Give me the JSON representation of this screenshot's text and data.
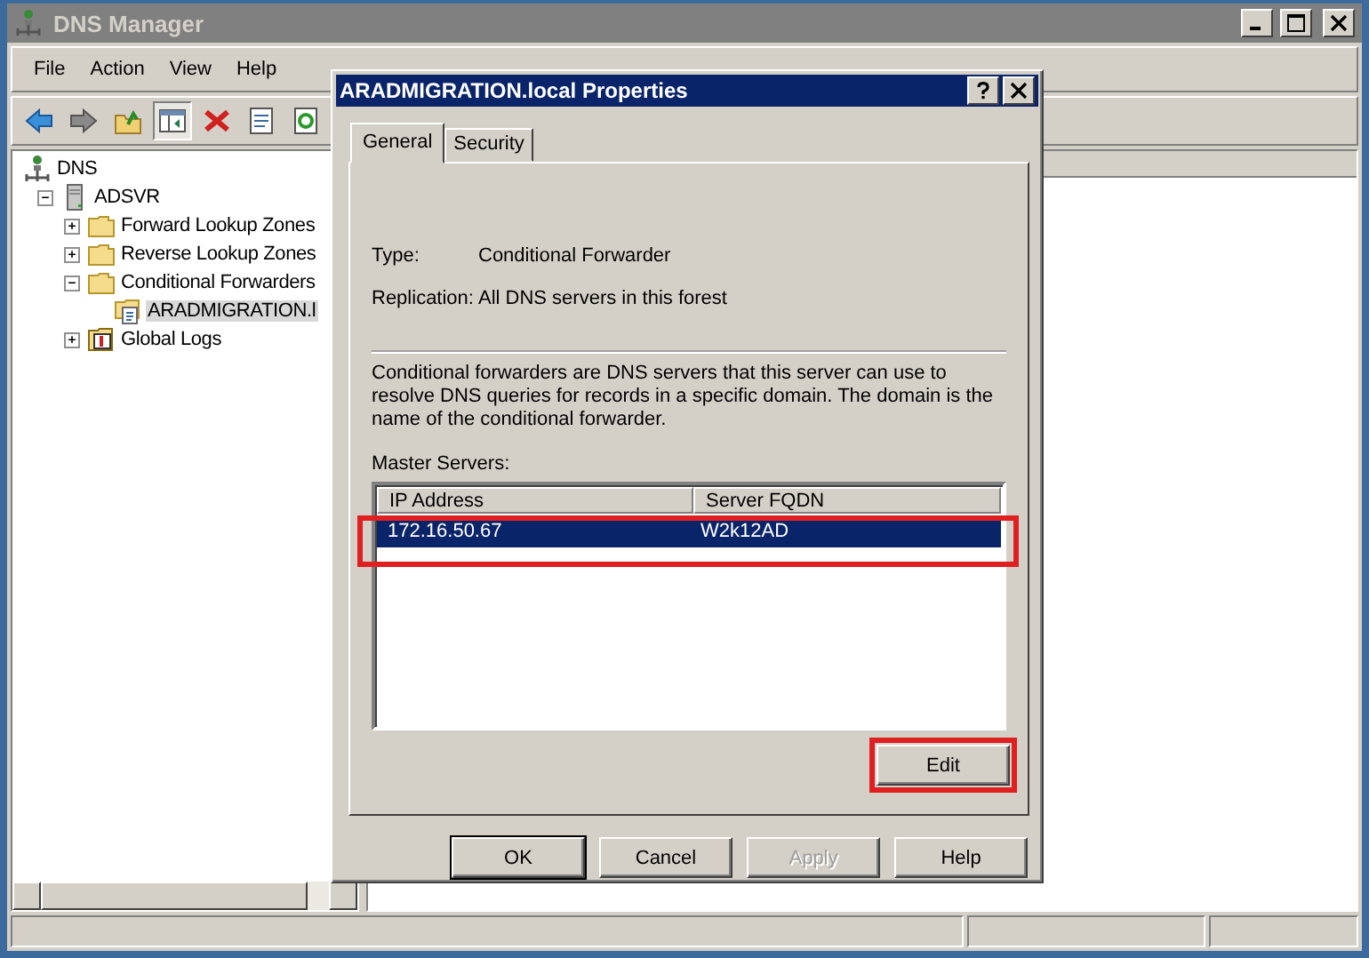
{
  "window": {
    "title": "DNS Manager"
  },
  "menu": [
    "File",
    "Action",
    "View",
    "Help"
  ],
  "toolbar": [
    {
      "kind": "back",
      "pressed": false
    },
    {
      "kind": "forward",
      "pressed": false
    },
    {
      "kind": "up",
      "pressed": false
    },
    {
      "kind": "tree",
      "pressed": true
    },
    {
      "kind": "delete",
      "pressed": false
    },
    {
      "kind": "properties",
      "pressed": false
    },
    {
      "kind": "refresh",
      "pressed": false
    }
  ],
  "tree": [
    {
      "label": "DNS",
      "kind": "dns",
      "selected": false,
      "children": [
        {
          "label": "ADSVR",
          "kind": "server",
          "expanded": true,
          "selected": false,
          "children": [
            {
              "label": "Forward Lookup Zones",
              "kind": "folder",
              "expanded": false,
              "selected": false
            },
            {
              "label": "Reverse Lookup Zones",
              "kind": "folder",
              "expanded": false,
              "selected": false
            },
            {
              "label": "Conditional Forwarders",
              "kind": "folder",
              "expanded": true,
              "selected": false,
              "children": [
                {
                  "label": "ARADMIGRATION.l",
                  "kind": "zone",
                  "selected": true
                }
              ]
            },
            {
              "label": "Global Logs",
              "kind": "log",
              "expanded": false,
              "selected": false
            }
          ]
        }
      ]
    }
  ],
  "dialog": {
    "title": "ARADMIGRATION.local Properties",
    "tabs": [
      {
        "label": "General",
        "selected": true
      },
      {
        "label": "Security",
        "selected": false
      }
    ],
    "type_label": "Type:",
    "type_value": "Conditional Forwarder",
    "replication_label": "Replication:",
    "replication_value": "All DNS servers in this forest",
    "description": "Conditional forwarders are DNS servers that this server can use to resolve DNS queries for records in a specific domain.  The domain is the name of the conditional forwarder.",
    "master_servers_label": "Master Servers:",
    "columns": [
      "IP Address",
      "Server FQDN"
    ],
    "rows": [
      {
        "ip": "172.16.50.67",
        "fqdn": "W2k12AD",
        "selected": true,
        "highlighted": true
      }
    ],
    "edit_button": {
      "label": "Edit",
      "highlighted": true
    },
    "buttons": [
      {
        "label": "OK",
        "disabled": false,
        "default": true
      },
      {
        "label": "Cancel",
        "disabled": false,
        "default": false
      },
      {
        "label": "Apply",
        "disabled": true,
        "default": false
      },
      {
        "label": "Help",
        "disabled": false,
        "default": false
      }
    ]
  }
}
